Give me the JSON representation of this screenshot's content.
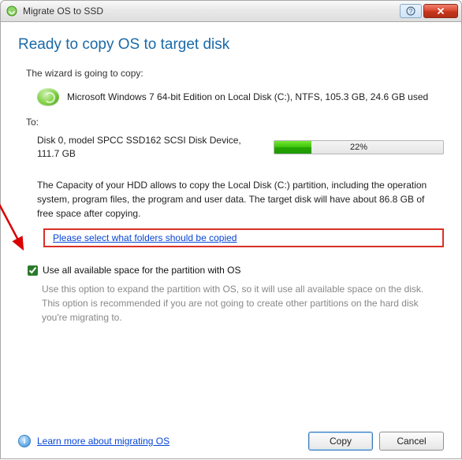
{
  "window": {
    "title": "Migrate OS to SSD"
  },
  "heading": "Ready to copy OS to target disk",
  "copy_intro": "The wizard is going to copy:",
  "source_desc": "Microsoft Windows 7 64-bit Edition on Local Disk (C:), NTFS, 105.3 GB, 24.6 GB used",
  "to_label": "To:",
  "target_desc": "Disk 0, model SPCC  SSD162 SCSI Disk Device, 111.7 GB",
  "progress": {
    "percent": 22,
    "label": "22%"
  },
  "capacity_text": "The Capacity of your HDD allows to copy the Local Disk (C:) partition, including the operation system, program files, the program and user data. The target disk will have about 86.8 GB of free space after copying.",
  "select_folders_link": "Please select what folders should be copied",
  "checkbox": {
    "label": "Use all available space for the partition with OS",
    "hint": "Use this option to expand the partition with OS, so it will use all available space on the disk. This option is recommended if you are not going to create other partitions on the hard disk you're migrating to."
  },
  "footer": {
    "learn_more": "Learn more about migrating OS",
    "copy_btn": "Copy",
    "cancel_btn": "Cancel"
  }
}
